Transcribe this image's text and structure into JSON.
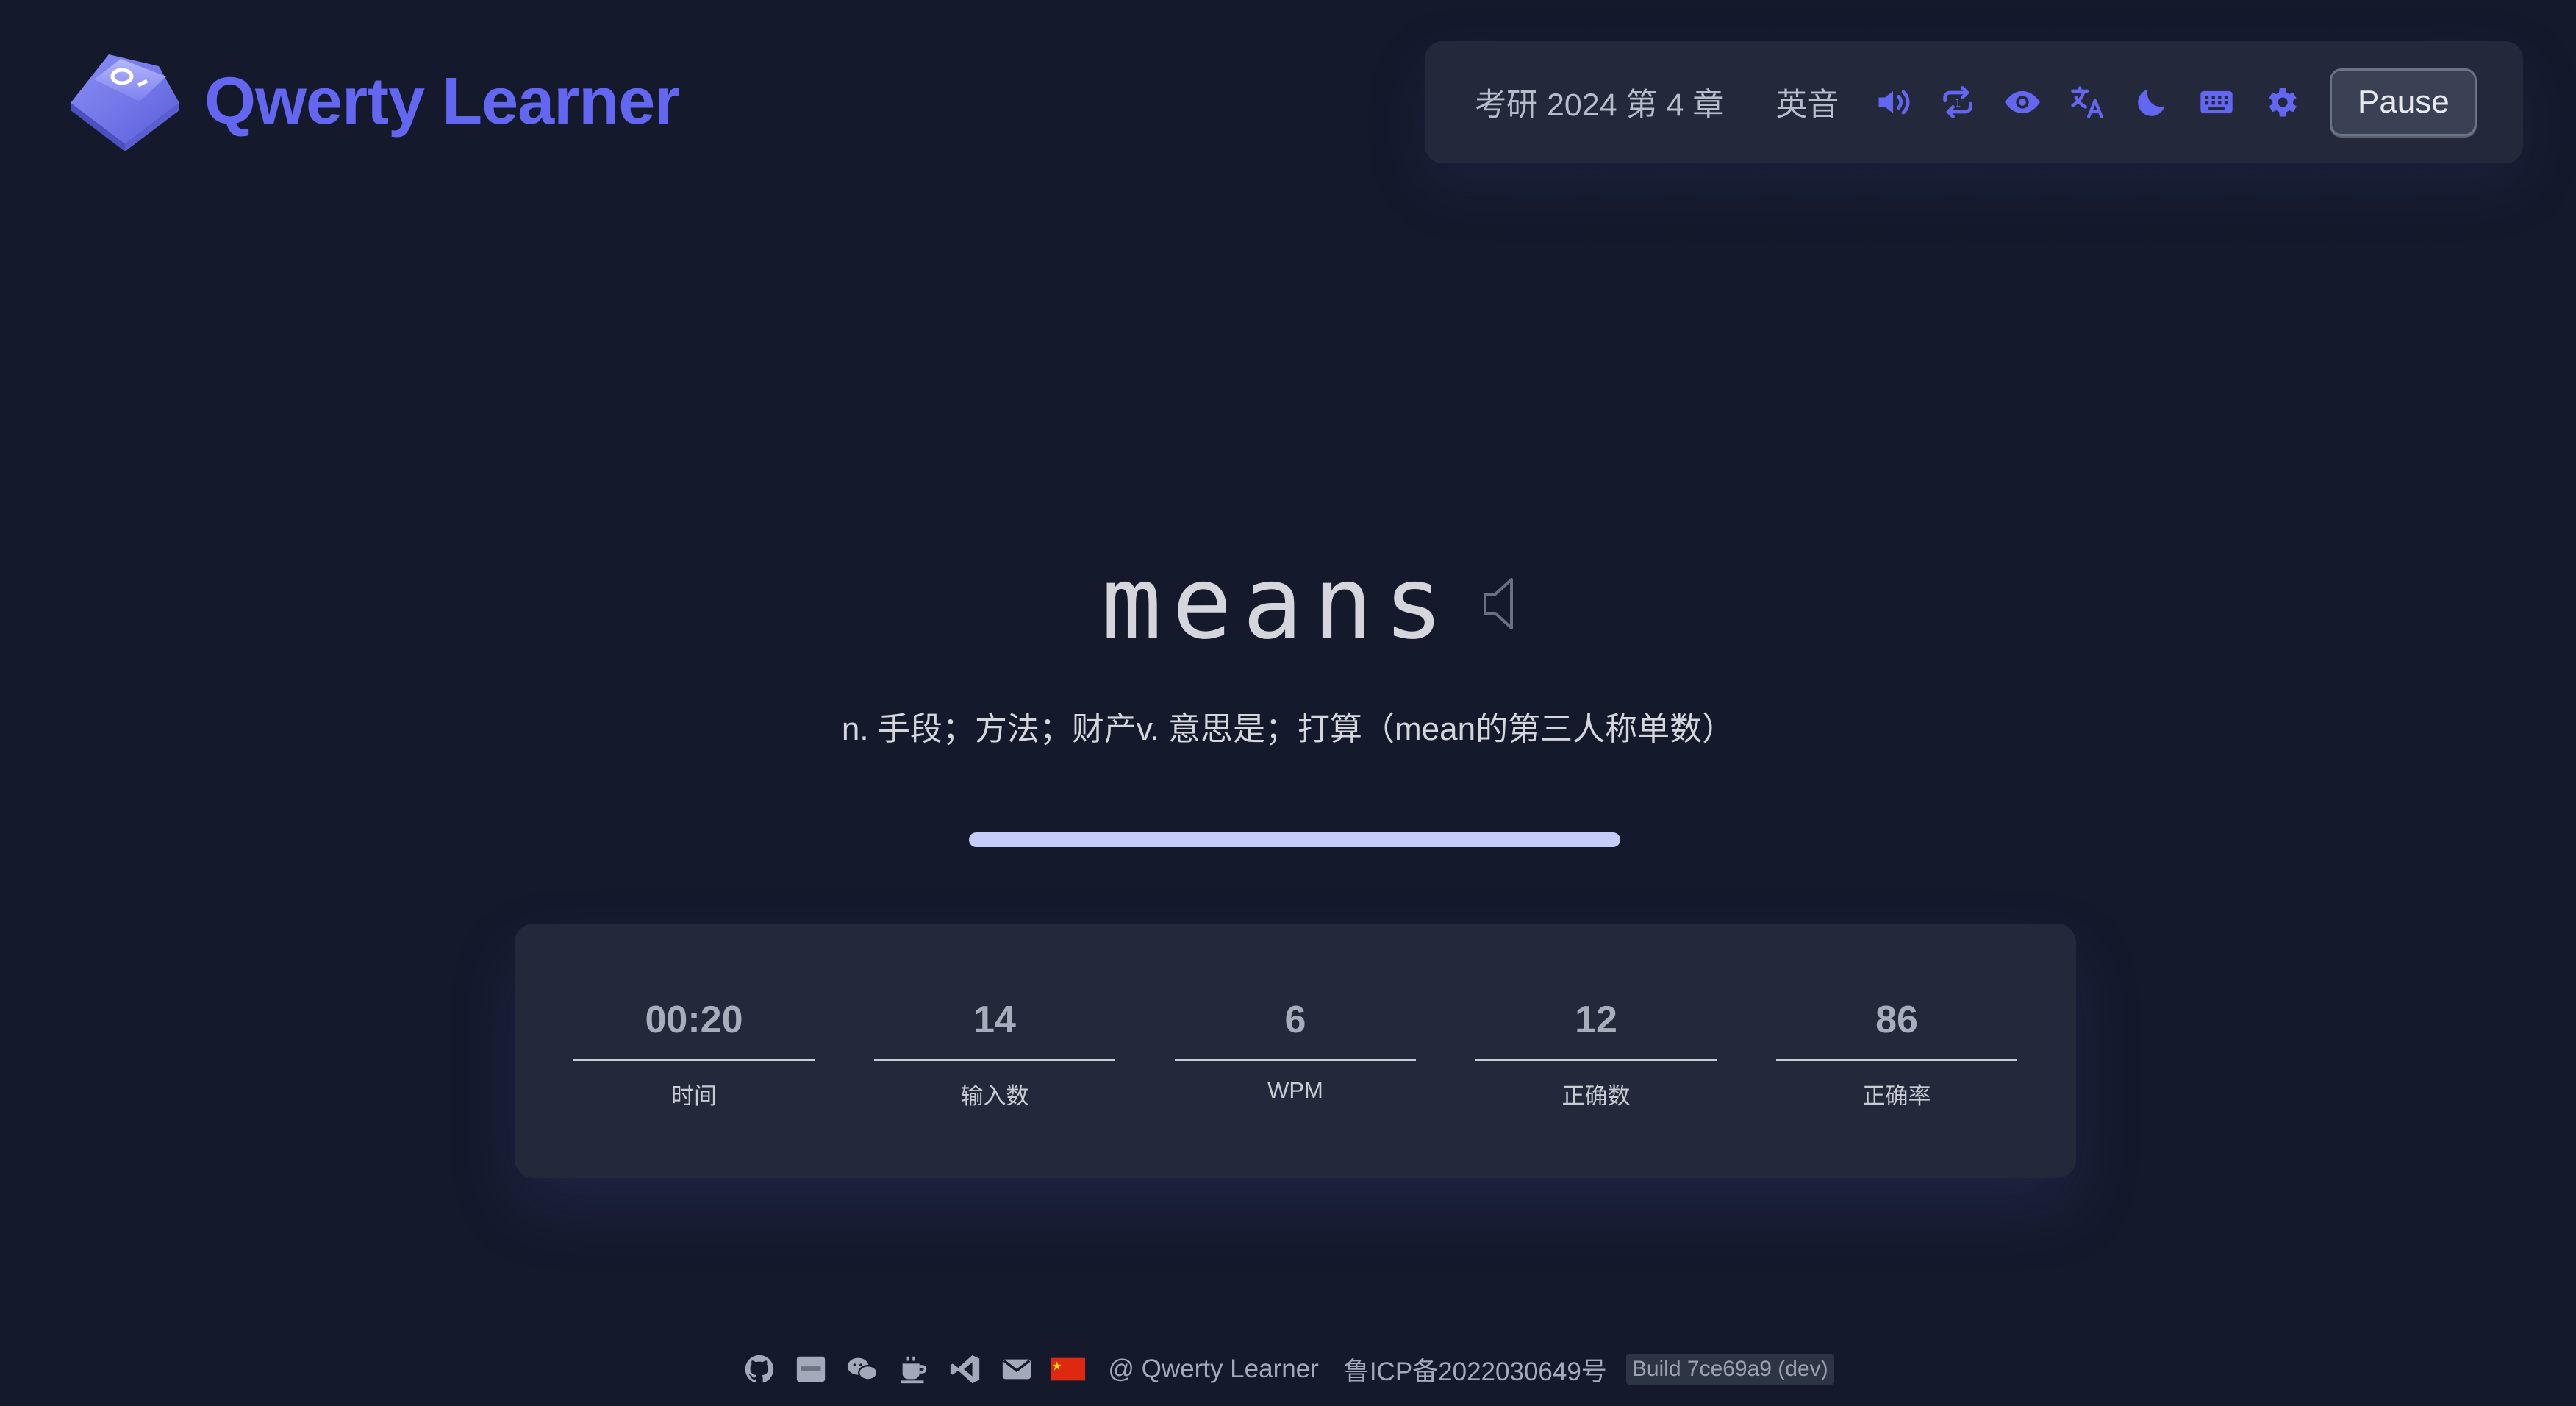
{
  "app": {
    "name": "Qwerty Learner"
  },
  "colors": {
    "accent": "#6366f1",
    "background": "#141a2b",
    "panel": "#23293a",
    "progress": "#c7cdfa"
  },
  "toolbar": {
    "dict_chapter": "考研 2024 第 4 章",
    "pronunciation": "英音",
    "icons": [
      "speaker-icon",
      "loop-icon",
      "eye-icon",
      "translate-icon",
      "moon-icon",
      "keyboard-icon",
      "gear-icon"
    ],
    "pause_label": "Pause"
  },
  "word": {
    "text": "means",
    "translation": "n. 手段；方法；财产v. 意思是；打算（mean的第三人称单数）",
    "progress": 1.0
  },
  "stats": [
    {
      "value": "00:20",
      "label": "时间"
    },
    {
      "value": "14",
      "label": "输入数"
    },
    {
      "value": "6",
      "label": "WPM"
    },
    {
      "value": "12",
      "label": "正确数"
    },
    {
      "value": "86",
      "label": "正确率"
    }
  ],
  "footer": {
    "icons": [
      "github-icon",
      "badge-icon",
      "wechat-icon",
      "coffee-icon",
      "vscode-icon",
      "mail-icon",
      "china-flag-icon"
    ],
    "credit": "@ Qwerty Learner",
    "icp": "鲁ICP备2022030649号",
    "build": "Build 7ce69a9 (dev)"
  }
}
